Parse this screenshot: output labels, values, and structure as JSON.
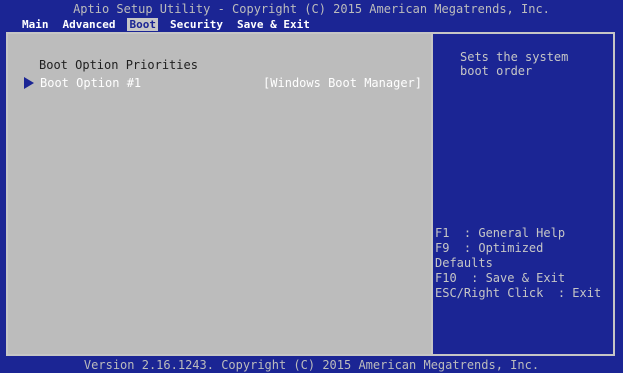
{
  "header": {
    "title": "Aptio Setup Utility - Copyright (C) 2015 American Megatrends, Inc."
  },
  "menu": {
    "tabs": [
      {
        "label": "Main",
        "active": false
      },
      {
        "label": "Advanced",
        "active": false
      },
      {
        "label": "Boot",
        "active": true
      },
      {
        "label": "Security",
        "active": false
      },
      {
        "label": "Save & Exit",
        "active": false
      }
    ]
  },
  "main": {
    "section_title": "Boot Option Priorities",
    "options": [
      {
        "label": "Boot Option #1",
        "value": "[Windows Boot Manager]",
        "selected": true
      }
    ]
  },
  "help": {
    "text": "Sets the system\nboot order"
  },
  "keys": {
    "lines": [
      "F1  : General Help",
      "F9  : Optimized",
      "Defaults",
      "F10  : Save & Exit",
      "ESC/Right Click  : Exit"
    ]
  },
  "footer": {
    "version": "Version 2.16.1243. Copyright (C) 2015 American Megatrends, Inc."
  },
  "colors": {
    "background": "#1b2594",
    "panel": "#bcbcbc",
    "highlight_text": "#ffffff",
    "dim_text": "#c6c6c6"
  }
}
